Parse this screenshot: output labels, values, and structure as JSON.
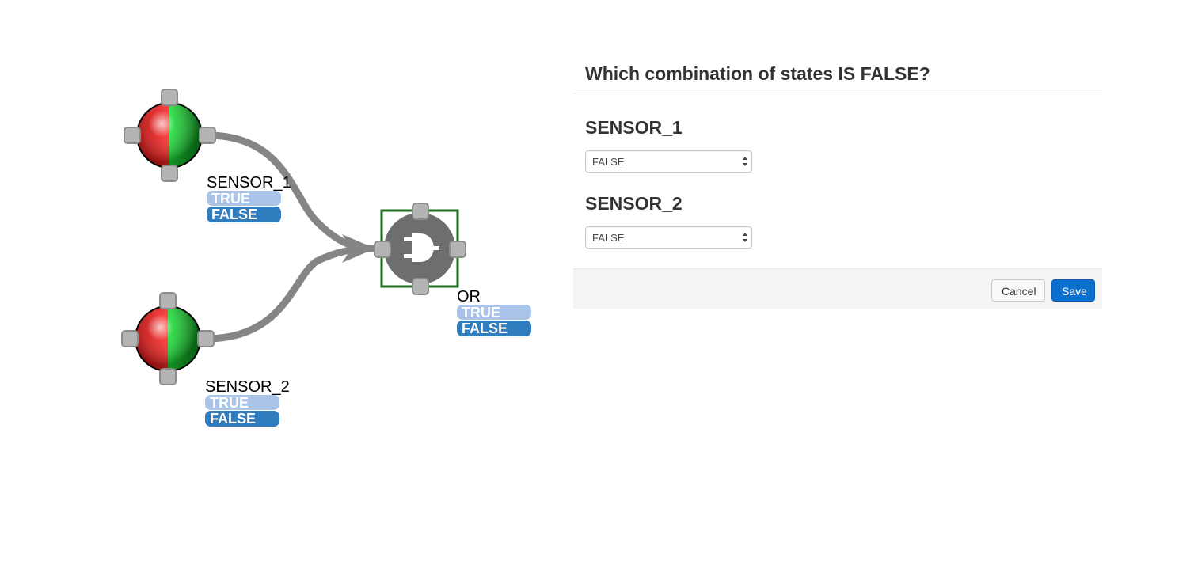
{
  "graph": {
    "sensor_1": {
      "name": "SENSOR_1",
      "states": [
        "TRUE",
        "FALSE"
      ]
    },
    "sensor_2": {
      "name": "SENSOR_2",
      "states": [
        "TRUE",
        "FALSE"
      ]
    },
    "gate": {
      "name": "OR",
      "icon": "plug-icon",
      "states": [
        "TRUE",
        "FALSE"
      ]
    },
    "colors": {
      "state_true": "#a9c4e8",
      "state_false": "#2f7dbf",
      "edge": "#858585",
      "selection": "#1e6b1e",
      "gate": "#6e6e6e",
      "handle": "#b4b4b4"
    }
  },
  "dialog": {
    "title": "Which combination of states IS FALSE?",
    "fields": [
      {
        "label": "SENSOR_1",
        "selected": "FALSE"
      },
      {
        "label": "SENSOR_2",
        "selected": "FALSE"
      }
    ],
    "cancel_label": "Cancel",
    "save_label": "Save",
    "colors": {
      "save_bg": "#0b6fcf",
      "footer_bg": "#f4f4f4"
    }
  }
}
